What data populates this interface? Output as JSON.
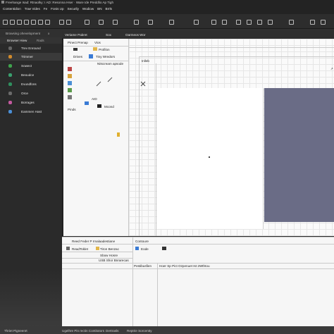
{
  "titlebar": {
    "title": "Freehange Isad: Rtnaolky: I AD: Resonna Hser · Ware Ide Preddlio Ap Tigh",
    "menu": [
      "Contentidion",
      "Trae Vides",
      "Fe",
      "Fonis Up",
      "Securily",
      "Wodiow",
      "BN",
      "Brrls"
    ]
  },
  "toolbar": {
    "left_label": "Browsing ohevelopment",
    "x_label": "x"
  },
  "left_panel": {
    "tabs": [
      "Browser Hiew",
      "Rads"
    ],
    "items": [
      {
        "label": "Trev Enround",
        "color": "#6c6c6c"
      },
      {
        "label": "Trimmer",
        "color": "#d28b2c"
      },
      {
        "label": "Sowect",
        "color": "#3fa34d"
      },
      {
        "label": "Beoudce",
        "color": "#3aa06e"
      },
      {
        "label": "Evundfons",
        "color": "#2f8f5e"
      },
      {
        "label": "Orce",
        "color": "#6b6b6b"
      },
      {
        "label": "Borrages",
        "color": "#c45aa0"
      },
      {
        "label": "Eammen Hast",
        "color": "#4b8fd6"
      }
    ]
  },
  "panel_tabs": {
    "items": [
      "Veriame Pabret",
      "Sox",
      "Oarmeos Wor"
    ]
  },
  "project_panel": {
    "title": "Pinect Prenap",
    "tab2": "Vios",
    "rows": [
      "Profilon",
      "Drives",
      "Tiny Wredors",
      "Nitscream apsode"
    ],
    "footer_labels": [
      "AID",
      "Pinds",
      "Mcond"
    ]
  },
  "canvas": {
    "ruler_label": "Inlleb"
  },
  "bottom_panel": {
    "tab1": "Reed Feder P",
    "tab2": "Imalaadestiane",
    "tab3": "Contoure",
    "row_a": "ReadToklet",
    "row_b": "Tiron Benzac",
    "row_c": "Sbow Hosre",
    "row_d": "USB Shor Bnrarecas",
    "row_e": "Eode",
    "row_f": "Pestibusfien",
    "row_g": "Hoer Sp Pict Ozpenuet Ist 2Wthtou"
  },
  "statusbar": {
    "items": [
      "Thriet Pigneenrt",
      "Ugelhre Pin rectin Contitotors",
      "Dertrasls",
      "Reptrie Sorcentty"
    ]
  }
}
